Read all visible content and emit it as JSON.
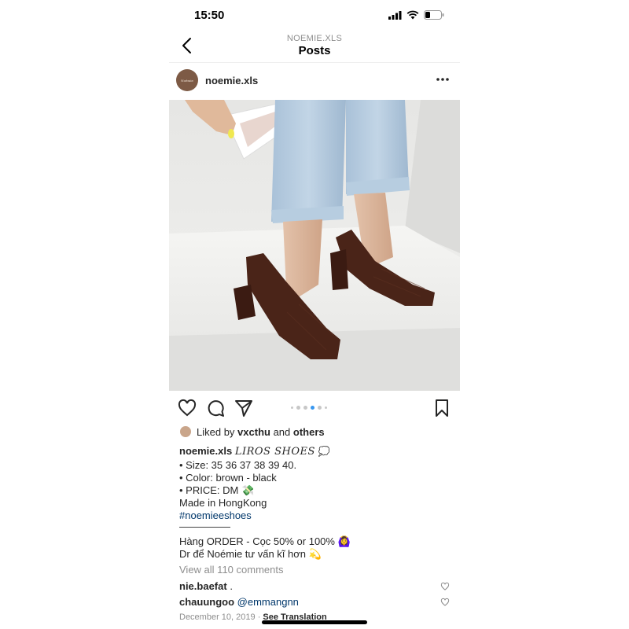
{
  "status": {
    "time": "15:50"
  },
  "nav": {
    "account": "NOEMIE.XLS",
    "title": "Posts"
  },
  "post": {
    "username": "noemie.xls",
    "avatar_text": "Noémie",
    "carousel": {
      "count": 6,
      "active_index": 3
    },
    "liked_prefix": "Liked by",
    "liked_user": "vxcthu",
    "liked_and": "and",
    "liked_others": "others",
    "caption": {
      "user": "noemie.xls",
      "brand": "LIROS SHOES",
      "brand_emoji": "💭",
      "lines": [
        "• Size: 35 36 37 38 39 40.",
        "• Color: brown - black",
        "• PRICE: DM 💸",
        "Made in HongKong"
      ],
      "hashtag": "#noemieeshoes",
      "divider": "—————",
      "order_line": "Hàng ORDER - Cọc 50% or 100% 🙆‍♀️",
      "dm_line": "Dr để Noémie tư vấn kĩ hơn 💫"
    },
    "view_comments": "View all 110 comments",
    "comments": [
      {
        "user": "nie.baefat",
        "text": "."
      },
      {
        "user": "chauungoo",
        "text": "@emmangnn"
      }
    ],
    "date": "December 10, 2019",
    "separator": "·",
    "see_translation": "See Translation"
  },
  "colors": {
    "link": "#00376b",
    "muted": "#8e8e8e",
    "active_dot": "#3897f0"
  },
  "icons": [
    "back-arrow-icon",
    "more-icon",
    "heart-icon",
    "comment-icon",
    "share-icon",
    "bookmark-icon",
    "signal-icon",
    "wifi-icon",
    "battery-icon"
  ]
}
